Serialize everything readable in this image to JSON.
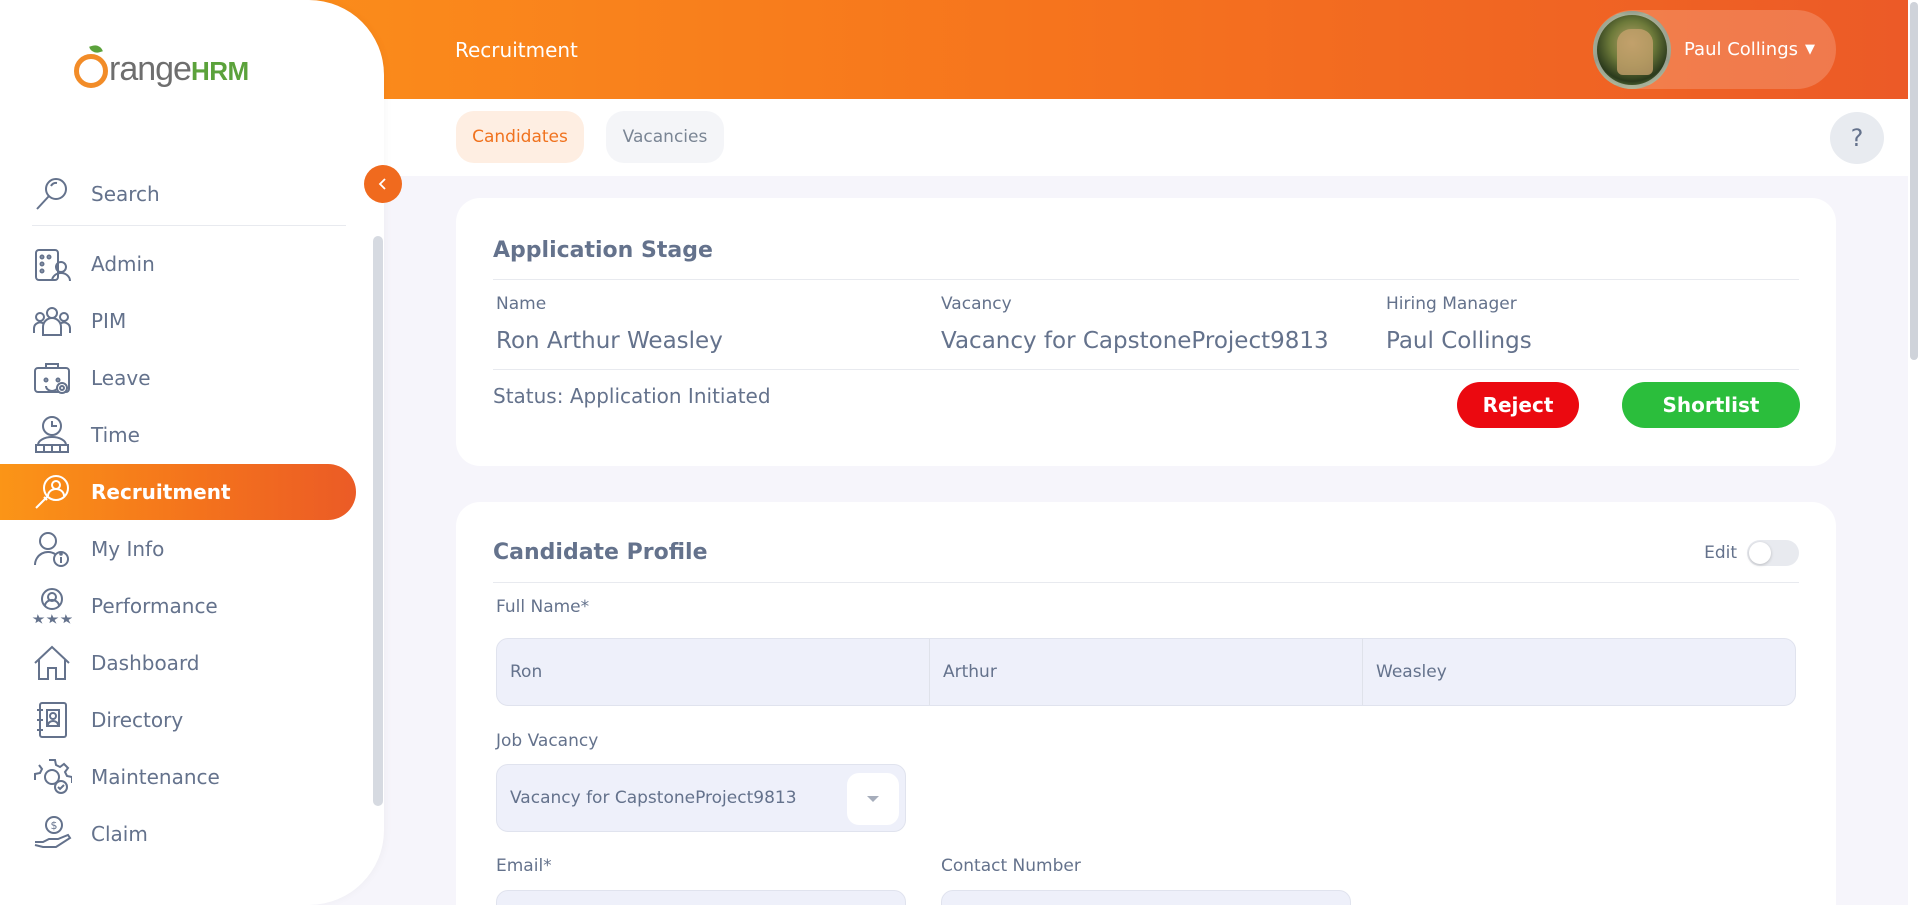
{
  "brand": {
    "name_main": "range",
    "name_suffix": "HRM"
  },
  "sidebar": {
    "search_label": "Search",
    "items": [
      {
        "label": "Admin",
        "icon": "admin-icon"
      },
      {
        "label": "PIM",
        "icon": "pim-icon"
      },
      {
        "label": "Leave",
        "icon": "leave-icon"
      },
      {
        "label": "Time",
        "icon": "time-icon"
      },
      {
        "label": "Recruitment",
        "icon": "recruitment-icon",
        "active": true
      },
      {
        "label": "My Info",
        "icon": "my-info-icon"
      },
      {
        "label": "Performance",
        "icon": "performance-icon"
      },
      {
        "label": "Dashboard",
        "icon": "dashboard-icon"
      },
      {
        "label": "Directory",
        "icon": "directory-icon"
      },
      {
        "label": "Maintenance",
        "icon": "maintenance-icon"
      },
      {
        "label": "Claim",
        "icon": "claim-icon"
      }
    ]
  },
  "header": {
    "title": "Recruitment",
    "user_name": "Paul Collings"
  },
  "tabs": [
    {
      "label": "Candidates",
      "active": true
    },
    {
      "label": "Vacancies",
      "active": false
    }
  ],
  "help_label": "?",
  "application_stage": {
    "title": "Application Stage",
    "name_label": "Name",
    "name_value": "Ron Arthur Weasley",
    "vacancy_label": "Vacancy",
    "vacancy_value": "Vacancy for CapstoneProject9813",
    "manager_label": "Hiring Manager",
    "manager_value": "Paul Collings",
    "status": "Status: Application Initiated",
    "reject_label": "Reject",
    "shortlist_label": "Shortlist"
  },
  "candidate_profile": {
    "title": "Candidate Profile",
    "edit_label": "Edit",
    "full_name_label": "Full Name*",
    "first_name": "Ron",
    "middle_name": "Arthur",
    "last_name": "Weasley",
    "job_vacancy_label": "Job Vacancy",
    "job_vacancy_value": "Vacancy for CapstoneProject9813",
    "email_label": "Email*",
    "contact_label": "Contact Number"
  },
  "colors": {
    "accent": "#f4731c",
    "reject": "#eb0910",
    "shortlist": "#2bbe3c"
  }
}
